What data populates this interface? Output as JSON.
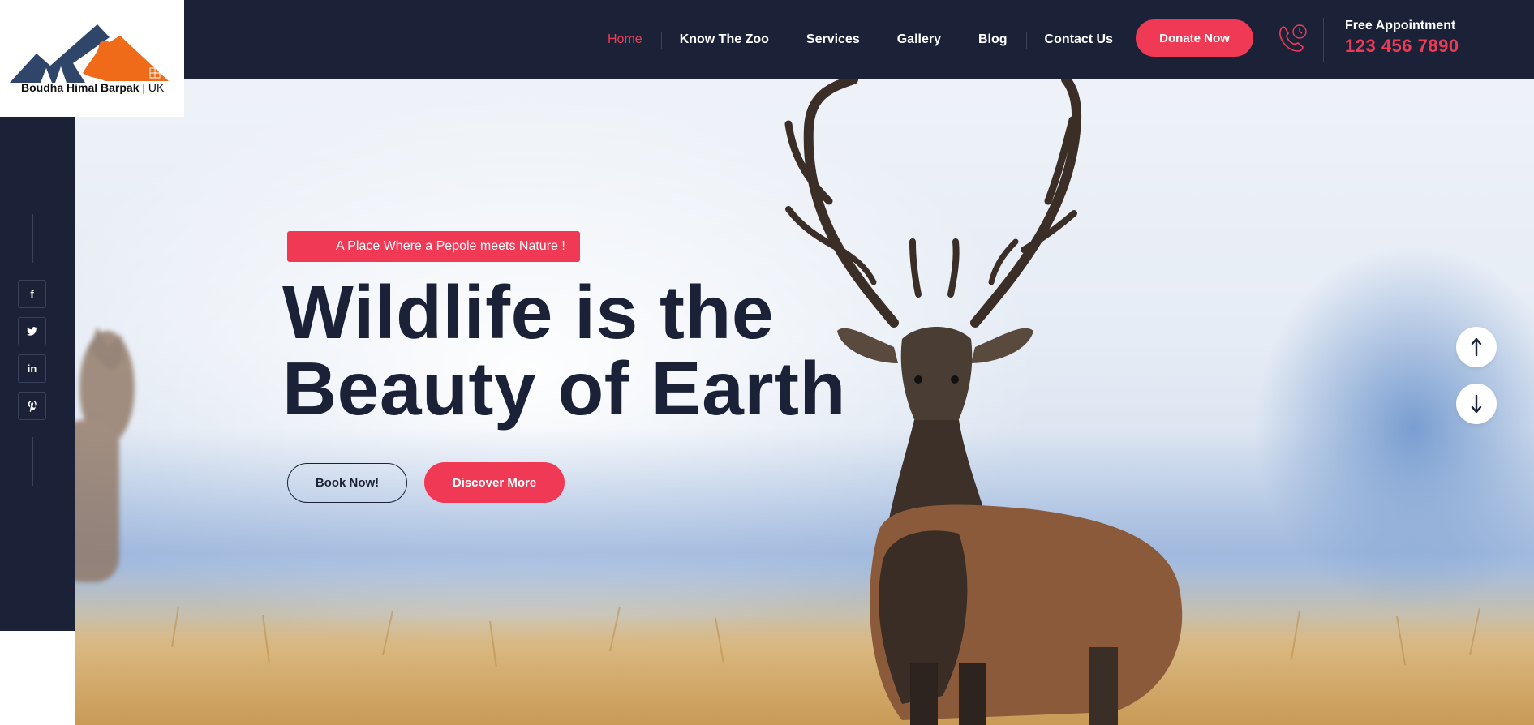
{
  "brand": {
    "name": "Boudha Himal Barpak",
    "suffix": "| UK",
    "colors": {
      "navy": "#1b2238",
      "accent": "#f03a55",
      "mountain_blue": "#2f4569",
      "mountain_orange": "#ef6b1a"
    }
  },
  "nav": {
    "items": [
      {
        "label": "Home",
        "active": true
      },
      {
        "label": "Know The Zoo",
        "active": false
      },
      {
        "label": "Services",
        "active": false
      },
      {
        "label": "Gallery",
        "active": false
      },
      {
        "label": "Blog",
        "active": false
      },
      {
        "label": "Contact Us",
        "active": false
      }
    ]
  },
  "header": {
    "donate_label": "Donate Now",
    "appointment_label": "Free Appointment",
    "appointment_phone": "123 456 7890",
    "phone_icon": "phone-call-icon"
  },
  "hero": {
    "tagline": "A Place Where a Pepole meets Nature !",
    "headline_line1": "Wildlife is the",
    "headline_line2": "Beauty of Earth",
    "book_label": "Book Now!",
    "discover_label": "Discover More",
    "scroll_up_icon": "arrow-up-icon",
    "scroll_down_icon": "arrow-down-icon"
  },
  "social": {
    "items": [
      {
        "icon": "facebook-icon",
        "glyph": "f"
      },
      {
        "icon": "twitter-icon",
        "glyph": "t"
      },
      {
        "icon": "linkedin-icon",
        "glyph": "in"
      },
      {
        "icon": "pinterest-icon",
        "glyph": "p"
      }
    ]
  }
}
